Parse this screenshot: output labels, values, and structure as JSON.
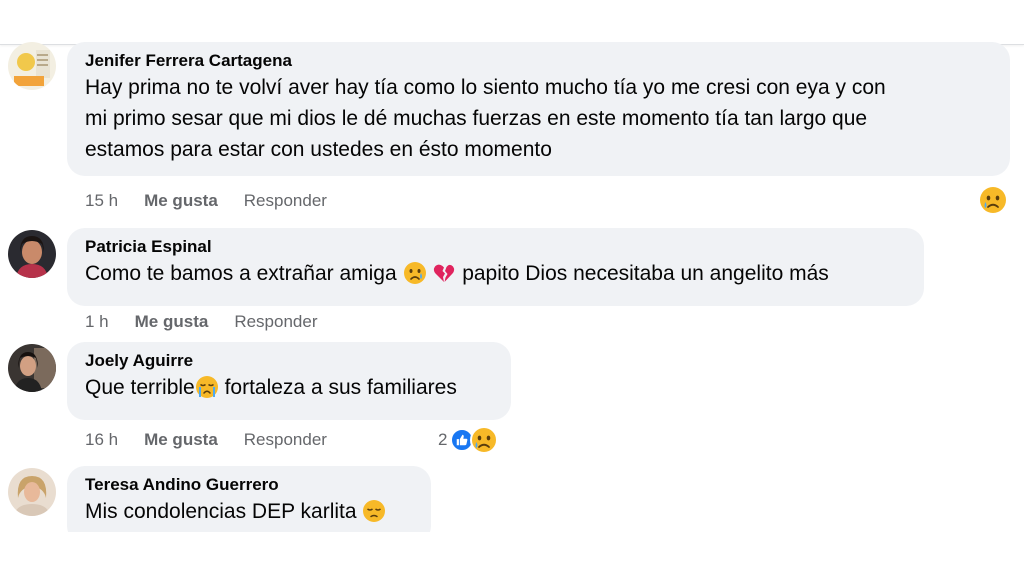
{
  "comments": [
    {
      "author": "Jenifer Ferrera Cartagena",
      "text_lines": [
        "Hay prima no te volví aver hay tía como lo siento mucho tía yo me cresi con eya y con",
        "mi primo sesar que mi dios le dé muchas fuerzas en este momento tía tan largo que",
        "estamos para estar con ustedes en ésto momento"
      ],
      "time": "15 h",
      "like_label": "Me gusta",
      "reply_label": "Responder",
      "reaction_icon": "sad-face-icon"
    },
    {
      "author": "Patricia Espinal",
      "text_before": "Como te bamos a extrañar amiga",
      "text_after": "papito Dios necesitaba un angelito más",
      "emojis": [
        "sad-face-emoji",
        "broken-heart-emoji"
      ],
      "time": "1 h",
      "like_label": "Me gusta",
      "reply_label": "Responder"
    },
    {
      "author": "Joely Aguirre",
      "text_before": "Que terrible",
      "text_after": "fortaleza a sus familiares",
      "emojis": [
        "crying-face-emoji"
      ],
      "time": "16 h",
      "like_label": "Me gusta",
      "reply_label": "Responder",
      "reaction_count": "2",
      "reaction_icons": [
        "like-icon",
        "sad-face-icon"
      ]
    },
    {
      "author": "Teresa Andino Guerrero",
      "text": "Mis condolencias DEP karlita",
      "emojis": [
        "pensive-face-emoji"
      ]
    }
  ],
  "colors": {
    "bubble": "#f0f2f5",
    "meta_text": "#65676b",
    "like_blue": "#1877f2",
    "emoji_yellow": "#f7b928",
    "heart_red": "#e0245e"
  }
}
